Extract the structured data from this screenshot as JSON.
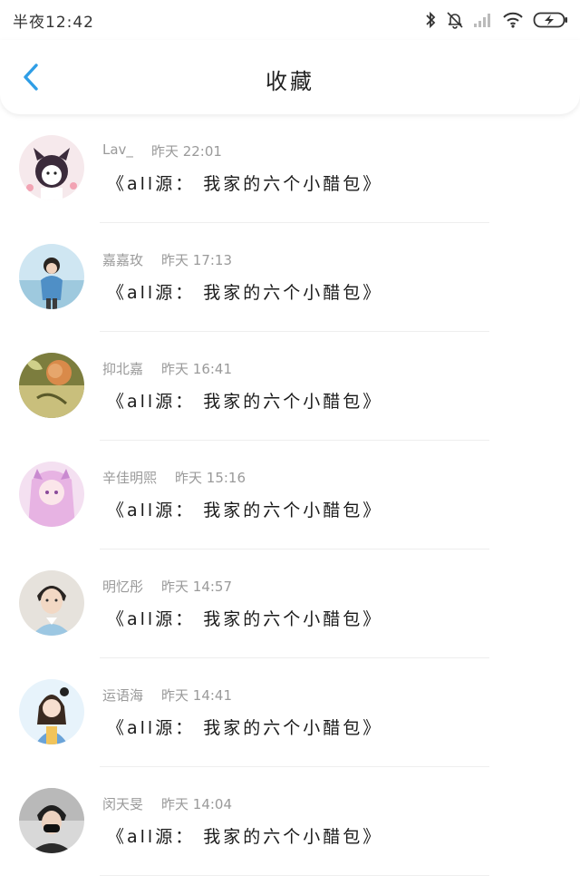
{
  "status_bar": {
    "time": "半夜12:42",
    "icons": [
      "bluetooth-icon",
      "mute-icon",
      "signal-icon",
      "wifi-icon",
      "battery-charging-icon"
    ]
  },
  "header": {
    "title": "收藏",
    "back_icon": "chevron-left-icon",
    "accent_color": "#2f9ee6"
  },
  "favorites": [
    {
      "user": "Lav_",
      "time": "昨天 22:01",
      "title": "《all源： 我家的六个小醋包》"
    },
    {
      "user": "嘉嘉玫",
      "time": "昨天 17:13",
      "title": "《all源： 我家的六个小醋包》"
    },
    {
      "user": "抑北嘉",
      "time": "昨天 16:41",
      "title": "《all源： 我家的六个小醋包》"
    },
    {
      "user": "辛佳明煕",
      "time": "昨天 15:16",
      "title": "《all源： 我家的六个小醋包》"
    },
    {
      "user": "明忆彤",
      "time": "昨天 14:57",
      "title": "《all源： 我家的六个小醋包》"
    },
    {
      "user": "运语海",
      "time": "昨天 14:41",
      "title": "《all源： 我家的六个小醋包》"
    },
    {
      "user": "闵天旻",
      "time": "昨天 14:04",
      "title": "《all源： 我家的六个小醋包》"
    }
  ]
}
